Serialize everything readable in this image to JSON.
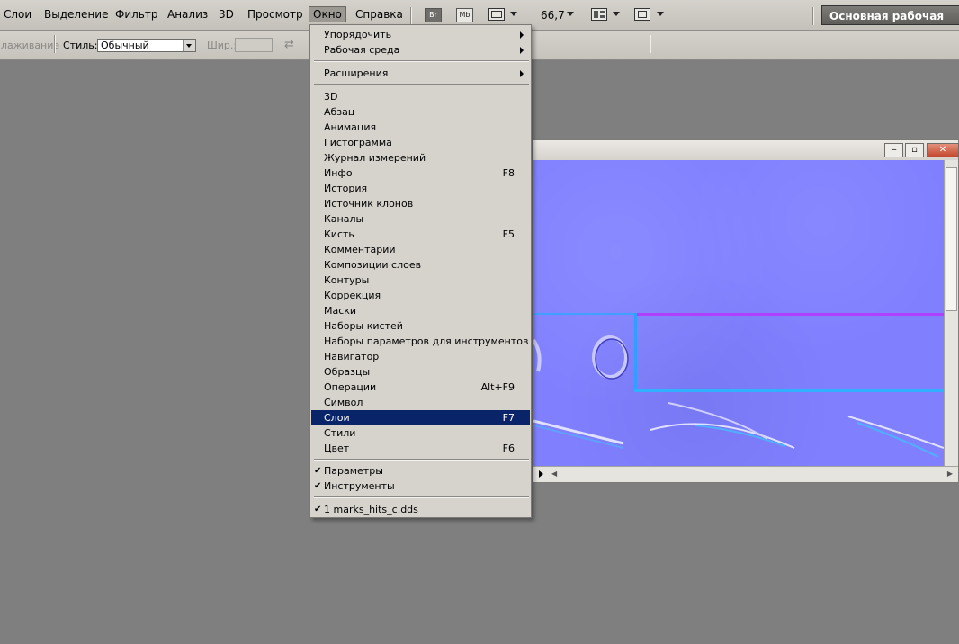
{
  "menubar": {
    "items": [
      "Слои",
      "Выделение",
      "Фильтр",
      "Анализ",
      "3D",
      "Просмотр",
      "Окно",
      "Справка"
    ],
    "active_item": "Окно",
    "toolbar": {
      "br_label": "Br",
      "mb_label": "Mb",
      "zoom": "66,7"
    },
    "workspace_label": "Основная рабочая среда"
  },
  "options": {
    "smoothing_label": "лаживание",
    "style_label": "Стиль:",
    "style_value": "Обычный",
    "width_label": "Шир.:"
  },
  "window_menu": {
    "top": [
      {
        "label": "Упорядочить",
        "submenu": true
      },
      {
        "label": "Рабочая среда",
        "submenu": true
      }
    ],
    "extensions": {
      "label": "Расширения",
      "submenu": true
    },
    "panels": [
      {
        "label": "3D"
      },
      {
        "label": "Абзац"
      },
      {
        "label": "Анимация"
      },
      {
        "label": "Гистограмма"
      },
      {
        "label": "Журнал измерений"
      },
      {
        "label": "Инфо",
        "shortcut": "F8"
      },
      {
        "label": "История"
      },
      {
        "label": "Источник клонов"
      },
      {
        "label": "Каналы"
      },
      {
        "label": "Кисть",
        "shortcut": "F5"
      },
      {
        "label": "Комментарии"
      },
      {
        "label": "Композиции слоев"
      },
      {
        "label": "Контуры"
      },
      {
        "label": "Коррекция"
      },
      {
        "label": "Маски"
      },
      {
        "label": "Наборы кистей"
      },
      {
        "label": "Наборы параметров для инструментов"
      },
      {
        "label": "Навигатор"
      },
      {
        "label": "Образцы"
      },
      {
        "label": "Операции",
        "shortcut": "Alt+F9"
      },
      {
        "label": "Символ"
      },
      {
        "label": "Слои",
        "shortcut": "F7",
        "selected": true
      },
      {
        "label": "Стили"
      },
      {
        "label": "Цвет",
        "shortcut": "F6"
      }
    ],
    "checked": [
      {
        "label": "Параметры",
        "checked": true
      },
      {
        "label": "Инструменты",
        "checked": true
      }
    ],
    "documents": [
      {
        "label": "1 marks_hits_c.dds",
        "checked": true
      }
    ]
  },
  "document_window": {
    "minimize_symbol": "‒",
    "maximize_symbol": "▫",
    "close_symbol": "✕"
  },
  "icons": {
    "check": "✔",
    "swap": "⇄"
  }
}
